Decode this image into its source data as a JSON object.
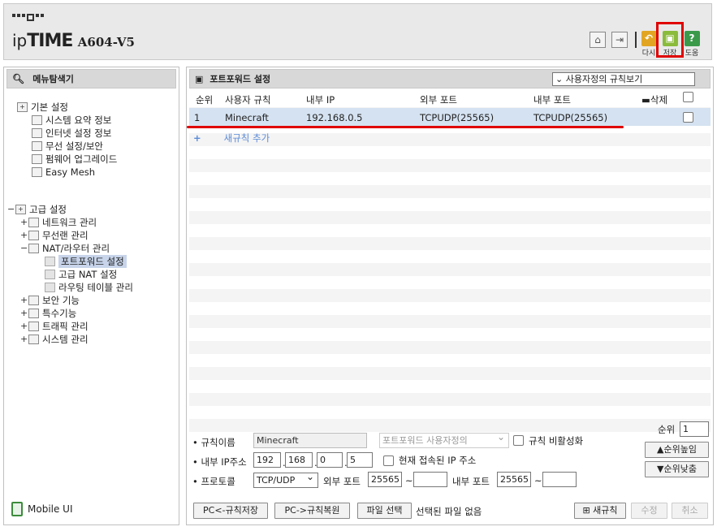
{
  "header": {
    "logo_prefix": "ip",
    "logo_bold": "TIME",
    "model": "A604-V5",
    "tools": [
      {
        "name": "reload",
        "label": "다시",
        "color": "#e1a523",
        "glyph": "↶"
      },
      {
        "name": "save",
        "label": "저장",
        "color": "#8bbb3b",
        "glyph": "▣"
      },
      {
        "name": "help",
        "label": "도움",
        "color": "#3b9a4a",
        "glyph": "?"
      }
    ]
  },
  "sidebar": {
    "title": "메뉴탐색기",
    "basic": {
      "label": "기본 설정",
      "items": [
        "시스템 요약 정보",
        "인터넷 설정 정보",
        "무선 설정/보안",
        "펌웨어 업그레이드",
        "Easy Mesh"
      ]
    },
    "advanced": {
      "label": "고급 설정",
      "items": [
        "네트워크 관리",
        "무선랜 관리",
        "NAT/라우터 관리",
        "보안 기능",
        "특수기능",
        "트래픽 관리",
        "시스템 관리"
      ],
      "nat_children": [
        "포트포워드 설정",
        "고급 NAT 설정",
        "라우팅 테이블 관리"
      ]
    },
    "mobile_ui": "Mobile UI"
  },
  "main": {
    "title": "포트포워드 설정",
    "view_select": "사용자정의 규칙보기",
    "columns": [
      "순위",
      "사용자 규칙",
      "내부 IP",
      "외부 포트",
      "내부 포트",
      "삭제"
    ],
    "rows": [
      {
        "rank": "1",
        "name": "Minecraft",
        "internal_ip": "192.168.0.5",
        "external_port": "TCPUDP(25565)",
        "internal_port": "TCPUDP(25565)"
      }
    ],
    "add_rule": "새규칙 추가",
    "add_rule_icon": "+"
  },
  "form": {
    "rule_name_label": "규칙이름",
    "rule_name": "Minecraft",
    "preset_select": "포트포워드 사용자정의",
    "disable_rule": "규칙 비활성화",
    "internal_ip_label": "내부 IP주소",
    "ip_parts": [
      "192",
      "168",
      "0",
      "5"
    ],
    "current_ip": "현재 접속된 IP 주소",
    "protocol_label": "프로토콜",
    "protocol": "TCP/UDP",
    "external_port_label": "외부 포트",
    "external_port_start": "25565",
    "external_port_end": "",
    "internal_port_label": "내부 포트",
    "internal_port_start": "25565",
    "internal_port_end": "",
    "tilde": "~",
    "rank_label": "순위",
    "rank": "1",
    "rank_up": "▲순위높임",
    "rank_down": "▼순위낮춤",
    "pc_save": "PC<-규칙저장",
    "pc_restore": "PC->규칙복원",
    "file_select": "파일 선택",
    "no_file": "선택된 파일 없음",
    "new_rule": "새규칙",
    "modify": "수정",
    "cancel": "취소"
  }
}
